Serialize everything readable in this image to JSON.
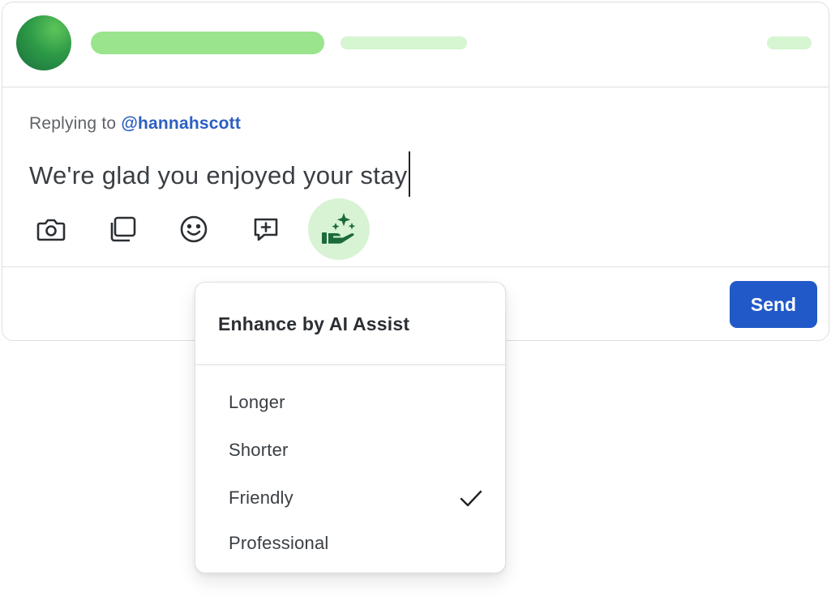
{
  "reply": {
    "replying_to_label": "Replying to",
    "handle": "@hannahscott",
    "text": "We're glad you enjoyed your stay"
  },
  "toolbar": {
    "icons": [
      "camera-icon",
      "gallery-icon",
      "emoji-icon",
      "add-comment-icon",
      "ai-assist-icon"
    ]
  },
  "send_button": {
    "label": "Send"
  },
  "ai_menu": {
    "title": "Enhance by AI Assist",
    "items": [
      {
        "label": "Longer",
        "selected": false
      },
      {
        "label": "Shorter",
        "selected": false
      },
      {
        "label": "Friendly",
        "selected": true
      },
      {
        "label": "Professional",
        "selected": false
      }
    ]
  },
  "colors": {
    "accent_blue": "#2159c8",
    "handle_blue": "#2b5fc2",
    "ai_green_bg": "#d7f3d3",
    "ai_green_icon": "#1b6b3a",
    "skeleton_green": "#9ae48d",
    "skeleton_light": "#d6f5d1"
  }
}
